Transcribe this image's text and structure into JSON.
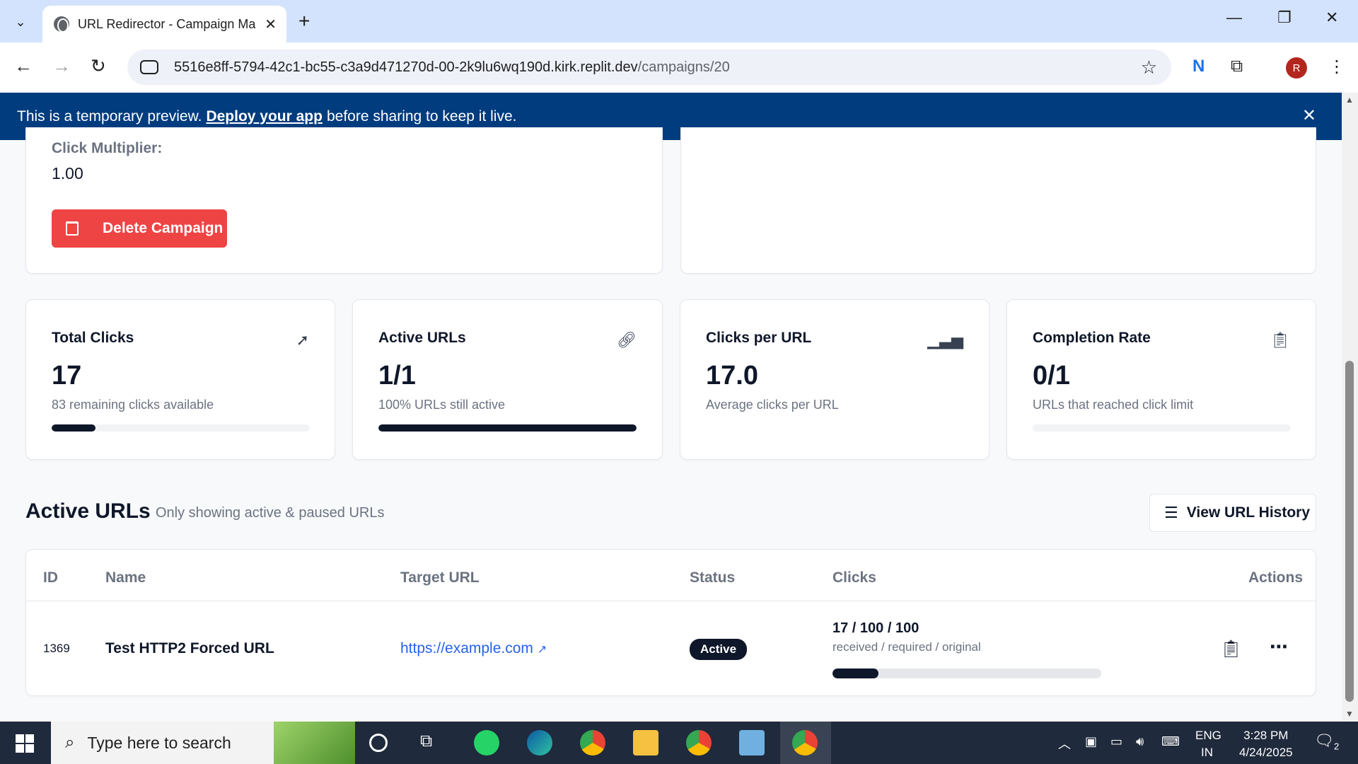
{
  "browser": {
    "tab_title": "URL Redirector - Campaign Ma",
    "url_host": "5516e8ff-5794-42c1-bc55-c3a9d471270d-00-2k9lu6wq190d.kirk.replit.dev",
    "url_path": "/campaigns/20",
    "profile_initial": "R"
  },
  "banner": {
    "text_before": "This is a temporary preview.",
    "link": "Deploy your app",
    "text_after": "before sharing to keep it live."
  },
  "campaign": {
    "multiplier_label": "Click Multiplier:",
    "multiplier_value": "1.00",
    "delete_label": "Delete Campaign"
  },
  "stats": [
    {
      "title": "Total Clicks",
      "value": "17",
      "sub": "83 remaining clicks available",
      "progress": 0.17,
      "icon": "cursor-icon"
    },
    {
      "title": "Active URLs",
      "value": "1/1",
      "sub": "100% URLs still active",
      "progress": 1.0,
      "icon": "link-icon"
    },
    {
      "title": "Clicks per URL",
      "value": "17.0",
      "sub": "Average clicks per URL",
      "icon": "bar-chart-icon"
    },
    {
      "title": "Completion Rate",
      "value": "0/1",
      "sub": "URLs that reached click limit",
      "progress": 0.0,
      "icon": "clipboard-check-icon"
    }
  ],
  "urls_section": {
    "title": "Active URLs",
    "subtitle": "Only showing active & paused URLs",
    "history_button": "View URL History",
    "columns": [
      "ID",
      "Name",
      "Target URL",
      "Status",
      "Clicks",
      "Actions"
    ],
    "rows": [
      {
        "id": "1369",
        "name": "Test HTTP2 Forced URL",
        "target": "https://example.com",
        "status": "Active",
        "clicks": "17 / 100 / 100",
        "clicks_caption": "received / required / original",
        "progress": 0.17
      }
    ]
  },
  "taskbar": {
    "search_placeholder": "Type here to search",
    "lang_top": "ENG",
    "lang_bottom": "IN",
    "time": "3:28 PM",
    "date": "4/24/2025",
    "notifications": "2"
  }
}
